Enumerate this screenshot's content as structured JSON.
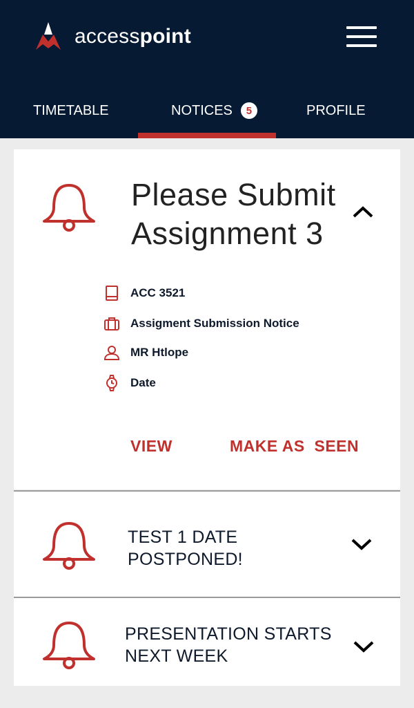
{
  "app": {
    "brand_light": "access",
    "brand_bold": "point"
  },
  "tabs": [
    {
      "label": "TIMETABLE"
    },
    {
      "label": "NOTICES",
      "badge": "5"
    },
    {
      "label": "PROFILE"
    }
  ],
  "notices": [
    {
      "title_line1": "Please Submit",
      "title_line2": "Assignment 3",
      "expanded": true,
      "details": [
        {
          "icon": "book-icon",
          "text": "ACC 3521"
        },
        {
          "icon": "briefcase-icon",
          "text": "Assigment Submission Notice"
        },
        {
          "icon": "person-icon",
          "text": "MR Htlope"
        },
        {
          "icon": "watch-icon",
          "text": "Date"
        }
      ],
      "actions": {
        "view": "VIEW",
        "mark_seen": "MAKE AS  SEEN"
      }
    },
    {
      "title_line1": "TEST 1 DATE",
      "title_line2": "POSTPONED!",
      "expanded": false
    },
    {
      "title_line1": "PRESENTATION STARTS",
      "title_line2": "NEXT WEEK",
      "expanded": false
    }
  ],
  "colors": {
    "header": "#071a33",
    "accent": "#c0312d",
    "background": "#ececec"
  }
}
